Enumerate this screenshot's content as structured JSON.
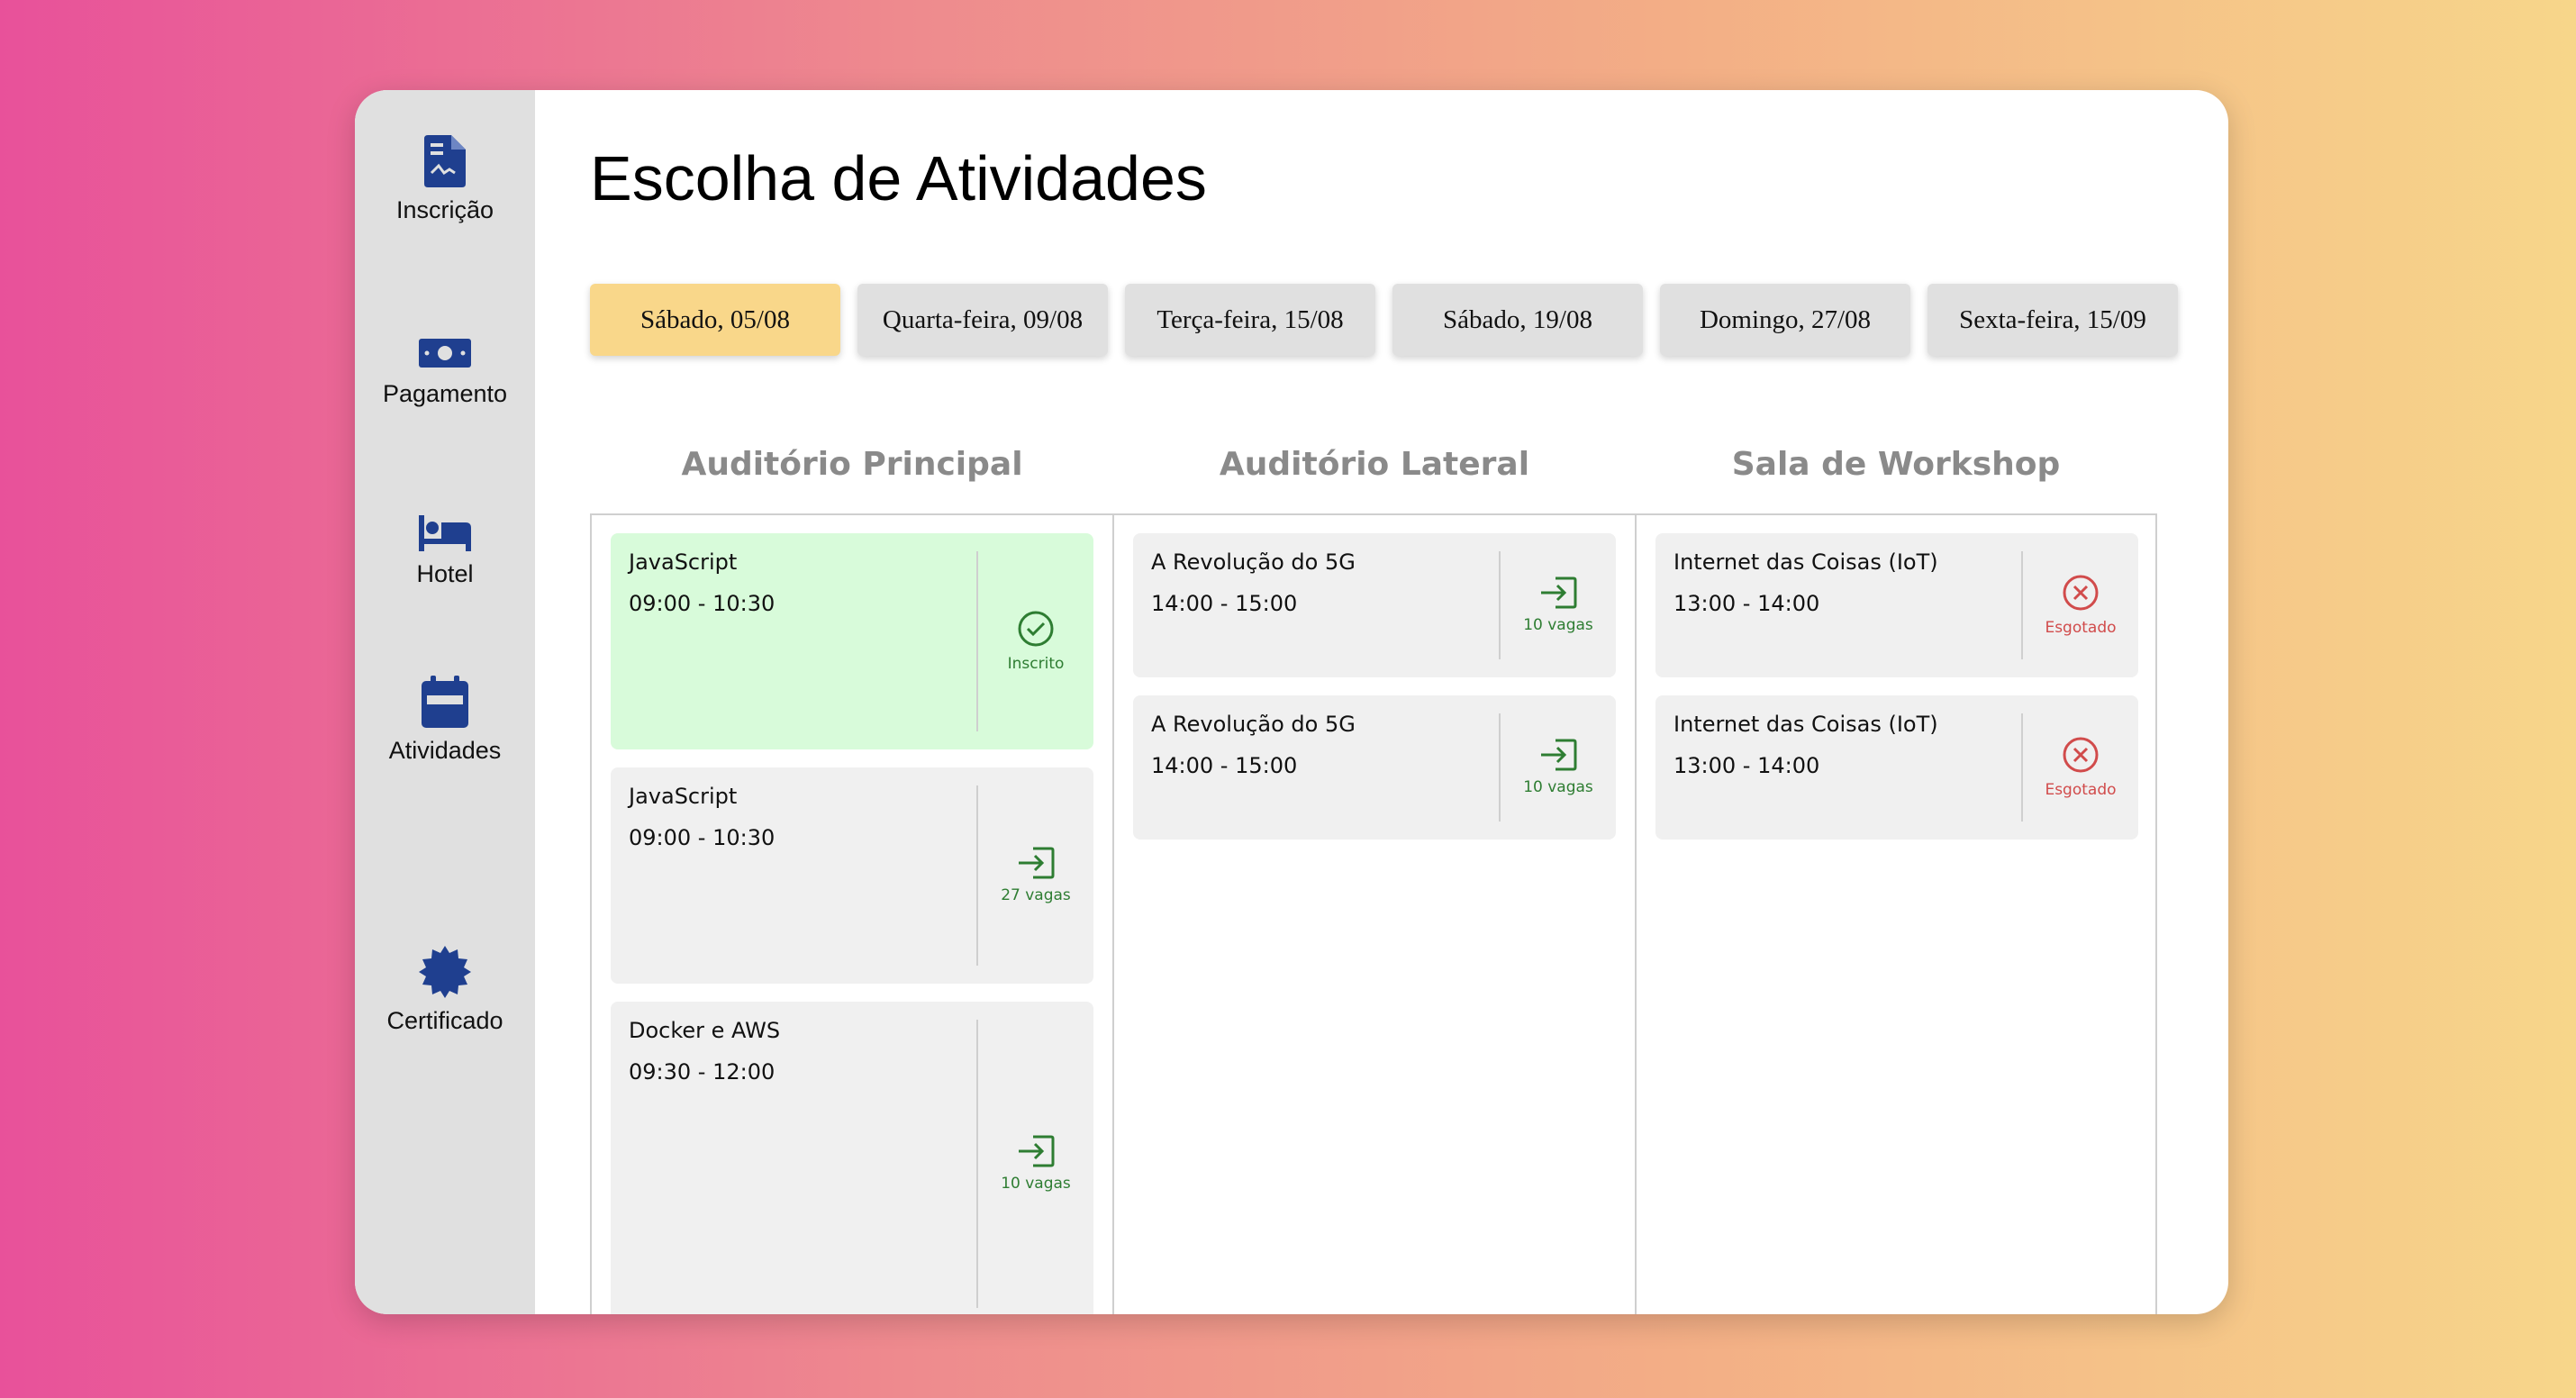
{
  "sidebar": {
    "items": [
      {
        "label": "Inscrição",
        "icon": "document-icon"
      },
      {
        "label": "Pagamento",
        "icon": "money-icon"
      },
      {
        "label": "Hotel",
        "icon": "bed-icon"
      },
      {
        "label": "Atividades",
        "icon": "calendar-icon"
      },
      {
        "label": "Certificado",
        "icon": "badge-icon"
      }
    ]
  },
  "main": {
    "title": "Escolha de Atividades",
    "days": [
      {
        "label": "Sábado, 05/08",
        "active": true
      },
      {
        "label": "Quarta-feira, 09/08",
        "active": false
      },
      {
        "label": "Terça-feira, 15/08",
        "active": false
      },
      {
        "label": "Sábado, 19/08",
        "active": false
      },
      {
        "label": "Domingo, 27/08",
        "active": false
      },
      {
        "label": "Sexta-feira, 15/09",
        "active": false
      }
    ],
    "rooms": [
      {
        "name": "Auditório Principal",
        "activities": [
          {
            "title": "JavaScript",
            "time": "09:00 - 10:30",
            "status": "Inscrito",
            "state": "enrolled"
          },
          {
            "title": "JavaScript",
            "time": "09:00 - 10:30",
            "status": "27 vagas",
            "state": "open"
          },
          {
            "title": "Docker e AWS",
            "time": "09:30 - 12:00",
            "status": "10 vagas",
            "state": "open"
          }
        ]
      },
      {
        "name": "Auditório Lateral",
        "activities": [
          {
            "title": "A Revolução do 5G",
            "time": "14:00 - 15:00",
            "status": "10 vagas",
            "state": "open"
          },
          {
            "title": "A Revolução do 5G",
            "time": "14:00 - 15:00",
            "status": "10 vagas",
            "state": "open"
          }
        ]
      },
      {
        "name": "Sala de Workshop",
        "activities": [
          {
            "title": "Internet das Coisas (IoT)",
            "time": "13:00 - 14:00",
            "status": "Esgotado",
            "state": "soldout"
          },
          {
            "title": "Internet das Coisas (IoT)",
            "time": "13:00 - 14:00",
            "status": "Esgotado",
            "state": "soldout"
          }
        ]
      }
    ]
  },
  "colors": {
    "sidebar_icon": "#1f3f8f",
    "active_tab": "#f9d78a",
    "enrolled_card": "#d8fbda",
    "open_green": "#2e7d32",
    "soldout_red": "#d14b4b"
  }
}
